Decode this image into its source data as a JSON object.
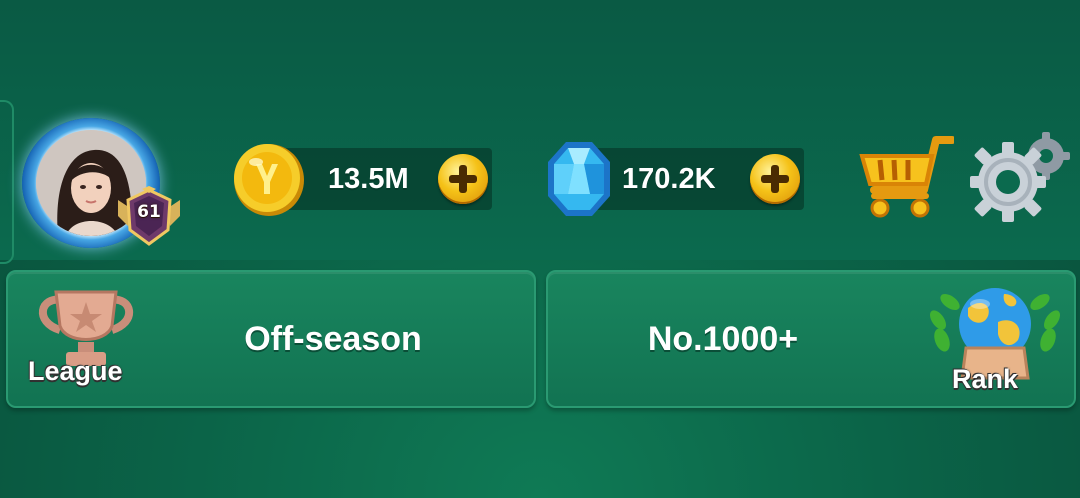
{
  "player": {
    "level": "61"
  },
  "resources": {
    "coins": {
      "value": "13.5M"
    },
    "gems": {
      "value": "170.2K"
    }
  },
  "league": {
    "label": "League",
    "status": "Off-season"
  },
  "rank": {
    "label": "Rank",
    "value": "No.1000+"
  },
  "colors": {
    "background": "#0b6448",
    "panel": "#127352",
    "accent_gold": "#f5c218",
    "gem_blue": "#35b8f0"
  },
  "icons": [
    "avatar",
    "level-badge",
    "coin-icon",
    "gem-icon",
    "plus-icon",
    "cart-icon",
    "gear-icon",
    "trophy-icon",
    "globe-icon"
  ]
}
